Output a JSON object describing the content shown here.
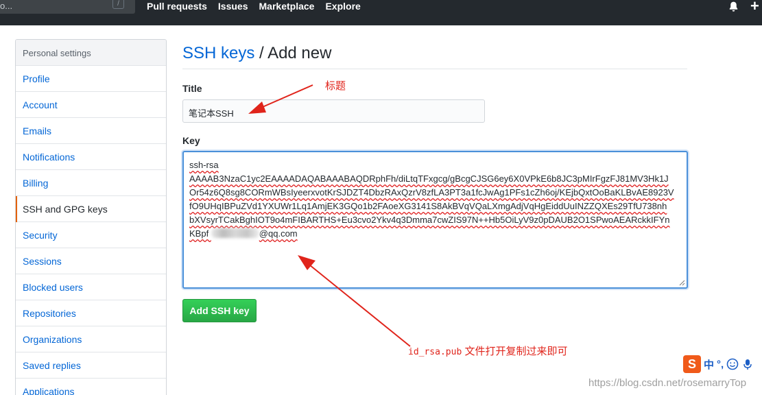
{
  "header": {
    "search_placeholder": "o...",
    "search_shortcut": "/",
    "nav": [
      "Pull requests",
      "Issues",
      "Marketplace",
      "Explore"
    ],
    "plus": "+"
  },
  "sidebar": {
    "heading": "Personal settings",
    "items": [
      {
        "label": "Profile"
      },
      {
        "label": "Account"
      },
      {
        "label": "Emails"
      },
      {
        "label": "Notifications"
      },
      {
        "label": "Billing"
      },
      {
        "label": "SSH and GPG keys",
        "selected": true
      },
      {
        "label": "Security"
      },
      {
        "label": "Sessions"
      },
      {
        "label": "Blocked users"
      },
      {
        "label": "Repositories"
      },
      {
        "label": "Organizations"
      },
      {
        "label": "Saved replies"
      },
      {
        "label": "Applications"
      }
    ]
  },
  "main": {
    "title_link": "SSH keys",
    "title_sep": " / ",
    "title_rest": "Add new",
    "title_label": "Title",
    "title_value": "笔记本SSH",
    "key_label": "Key",
    "key_lines": [
      "ssh-rsa",
      "AAAAB3NzaC1yc2EAAAADAQABAAABAQDRphFh/diLtqTFxgcg/gBcgCJSG6ey6X0VPkE6b8JC3pMIrFgzFJ81MV3Hk1J",
      "Or54z6Q8sg8CORmWBsIyeerxvotKrSJDZT4DbzRAxQzrV8zfLA3PT3a1fcJwAg1PFs1cZh6oj/KEjbQxtOoBaKLBvAE8923V",
      "fO9UHqIBPuZVd1YXUWr1Lq1AmjEK3GQo1b2FAoeXG3141S8AkBVqVQaLXmgAdjVqHgEiddUuINZZQXEs29TfU738nh",
      "bXVsyrTCakBghIOT9o4mFIBARTHS+Eu3cvo2Ykv4q3Dmma7cwZIS97N++Hb5OiLyV9z0pDAUB2O1SPwoAEARckkIFYn"
    ],
    "key_last_prefix": "KBpf ",
    "key_last_suffix": "@qq.com",
    "add_button": "Add SSH key"
  },
  "annotations": {
    "title_note": "标题",
    "key_note_code": "id_rsa.pub",
    "key_note_text": " 文件打开复制过来即可",
    "color": "#e0241b"
  },
  "ime": {
    "logo": "S",
    "lang": "中",
    "punct": "°,"
  },
  "watermark": "https://blog.csdn.net/rosemarryTop",
  "colors": {
    "link": "#0366d6",
    "header": "#24292e",
    "button": "#28a745",
    "selected_bar": "#e36209"
  }
}
